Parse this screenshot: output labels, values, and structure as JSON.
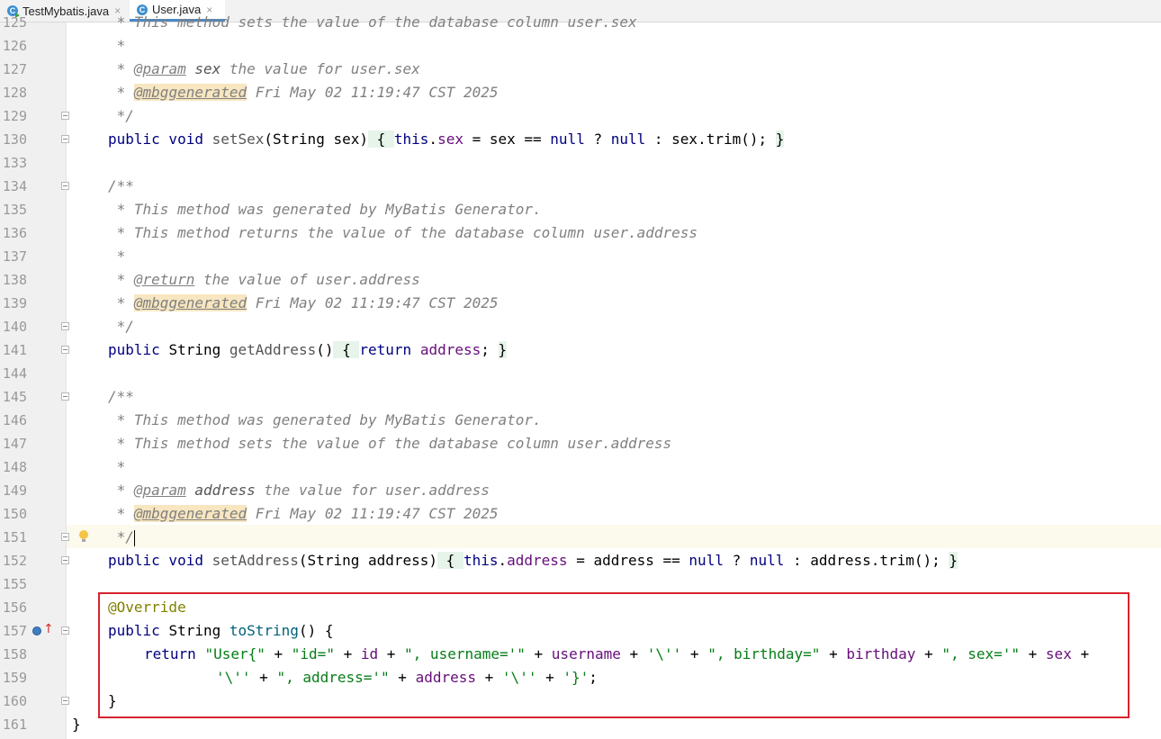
{
  "tabs": [
    {
      "label": "TestMybatis.java",
      "active": false,
      "icon": "c-class-run-icon",
      "close": "×"
    },
    {
      "label": "User.java",
      "active": true,
      "icon": "c-class-icon",
      "close": "×"
    }
  ],
  "lines": {
    "l125": {
      "num": "125",
      "t1": " * This method sets the value of the database column user.sex"
    },
    "l126": {
      "num": "126",
      "t1": " *"
    },
    "l127": {
      "num": "127",
      "t1": " * ",
      "t2": "@param",
      "t3": " ",
      "t4": "sex",
      "t5": " the value for user.sex"
    },
    "l128": {
      "num": "128",
      "t1": " * ",
      "t2": "@mbggenerated",
      "t3": " Fri May 02 11:19:47 CST 2025"
    },
    "l129": {
      "num": "129",
      "t1": " */"
    },
    "l130": {
      "num": "130",
      "t1": "public void ",
      "t2": "setSex",
      "t3": "(String sex)",
      "t4": " { ",
      "t5": "this",
      "t6": ".",
      "t7": "sex",
      "t8": " = sex == ",
      "t9": "null",
      "t10": " ? ",
      "t11": "null",
      "t12": " : sex.trim(); ",
      "t13": "}"
    },
    "l133": {
      "num": "133"
    },
    "l134": {
      "num": "134",
      "t1": "/**"
    },
    "l135": {
      "num": "135",
      "t1": " * This method was generated by MyBatis Generator."
    },
    "l136": {
      "num": "136",
      "t1": " * This method returns the value of the database column user.address"
    },
    "l137": {
      "num": "137",
      "t1": " *"
    },
    "l138": {
      "num": "138",
      "t1": " * ",
      "t2": "@return",
      "t3": " the value of user.address"
    },
    "l139": {
      "num": "139",
      "t1": " * ",
      "t2": "@mbggenerated",
      "t3": " Fri May 02 11:19:47 CST 2025"
    },
    "l140": {
      "num": "140",
      "t1": " */"
    },
    "l141": {
      "num": "141",
      "t1": "public ",
      "t2": "String ",
      "t3": "getAddress",
      "t4": "()",
      "t5": " { ",
      "t6": "return ",
      "t7": "address",
      "t8": "; ",
      "t9": "}"
    },
    "l144": {
      "num": "144"
    },
    "l145": {
      "num": "145",
      "t1": "/**"
    },
    "l146": {
      "num": "146",
      "t1": " * This method was generated by MyBatis Generator."
    },
    "l147": {
      "num": "147",
      "t1": " * This method sets the value of the database column user.address"
    },
    "l148": {
      "num": "148",
      "t1": " *"
    },
    "l149": {
      "num": "149",
      "t1": " * ",
      "t2": "@param",
      "t3": " ",
      "t4": "address",
      "t5": " the value for user.address"
    },
    "l150": {
      "num": "150",
      "t1": " * ",
      "t2": "@mbggenerated",
      "t3": " Fri May 02 11:19:47 CST 2025"
    },
    "l151": {
      "num": "151",
      "t1": " */"
    },
    "l152": {
      "num": "152",
      "t1": "public void ",
      "t2": "setAddress",
      "t3": "(String address)",
      "t4": " { ",
      "t5": "this",
      "t6": ".",
      "t7": "address",
      "t8": " = address == ",
      "t9": "null",
      "t10": " ? ",
      "t11": "null",
      "t12": " : address.trim(); ",
      "t13": "}"
    },
    "l155": {
      "num": "155"
    },
    "l156": {
      "num": "156",
      "t1": "@Override"
    },
    "l157": {
      "num": "157",
      "t1": "public ",
      "t2": "String ",
      "t3": "toString",
      "t4": "() {"
    },
    "l158": {
      "num": "158",
      "t1": "return ",
      "t2": "\"User{\"",
      "t3": " + ",
      "t4": "\"id=\"",
      "t5": " + ",
      "t6": "id",
      "t7": " + ",
      "t8": "\", username='\"",
      "t9": " + ",
      "t10": "username",
      "t11": " + ",
      "t12": "'\\''",
      "t13": " + ",
      "t14": "\", birthday=\"",
      "t15": " + ",
      "t16": "birthday",
      "t17": " + ",
      "t18": "\", sex='\"",
      "t19": " + ",
      "t20": "sex",
      "t21": " +"
    },
    "l159": {
      "num": "159",
      "t1": "'\\''",
      "t2": " + ",
      "t3": "\", address='\"",
      "t4": " + ",
      "t5": "address",
      "t6": " + ",
      "t7": "'\\''",
      "t8": " + ",
      "t9": "'}'",
      "t10": ";"
    },
    "l160": {
      "num": "160",
      "t1": "}"
    },
    "l161": {
      "num": "161",
      "t1": "}"
    }
  },
  "colors": {
    "keyword": "#000080",
    "comment": "#808080",
    "field": "#660e7a",
    "string": "#067d17",
    "annotation": "#808000",
    "highlight_box": "#d9232d"
  }
}
